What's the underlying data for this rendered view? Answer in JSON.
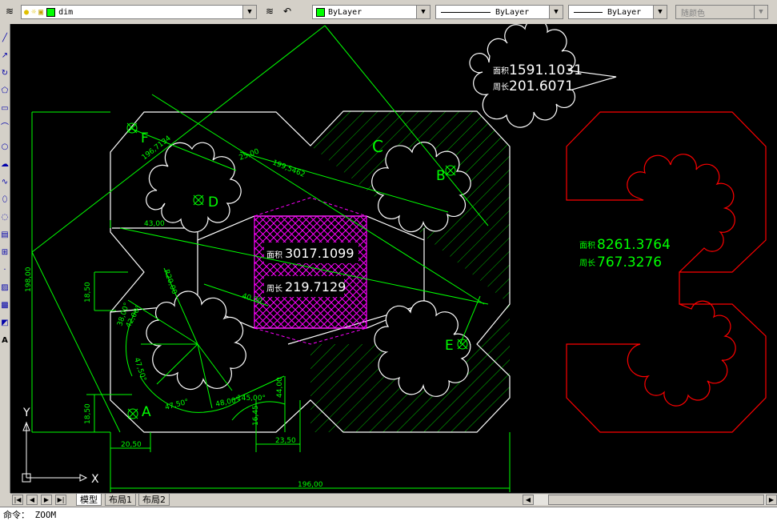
{
  "toolbar": {
    "layer_name": "dim",
    "color_combo": "ByLayer",
    "linetype_combo": "ByLayer",
    "lineweight_combo": "ByLayer",
    "plotstyle_combo": "随颜色"
  },
  "tabs": [
    {
      "label": "模型",
      "active": true
    },
    {
      "label": "布局1",
      "active": false
    },
    {
      "label": "布局2",
      "active": false
    }
  ],
  "command_line": "命令：  ZOOM",
  "drawing": {
    "point_labels": [
      "A",
      "B",
      "C",
      "D",
      "E",
      "F"
    ],
    "hatch_area_label": "面积",
    "hatch_area_value": "3017.1099",
    "hatch_perimeter_label": "周长",
    "hatch_perimeter_value": "219.7129",
    "callout_area_label": "面积",
    "callout_area_value": "1591.1031",
    "callout_perimeter_label": "周长",
    "callout_perimeter_value": "201.6071",
    "red_area_label": "面积",
    "red_area_value": "8261.3764",
    "red_perimeter_label": "周长",
    "red_perimeter_value": "767.3276",
    "dims": {
      "d196_top": "196,7134",
      "d199": "199,5462",
      "d25": "25,00",
      "d43": "43,00",
      "d198": "198,00",
      "d18_50_top": "18,50",
      "d18_50_bot": "18,50",
      "r20": "R20,00",
      "d40": "40,00",
      "d38": "38,00°",
      "d42": "42,00°",
      "d47_50_v": "47,50°",
      "d47_50_h": "47,50°",
      "d48": "48,00°",
      "d145": "145,00°",
      "d16_45": "16,45",
      "d44": "44,00",
      "d20_50": "20,50",
      "d23_50": "23,50",
      "d196_bottom": "196,00"
    },
    "ucs_x": "X",
    "ucs_y": "Y"
  },
  "colors": {
    "canvas_bg": "#000000",
    "dim": "#00ff00",
    "outline": "#ffffff",
    "hatch": "#00c000",
    "magenta": "#ff00ff",
    "red": "#ff0000"
  }
}
